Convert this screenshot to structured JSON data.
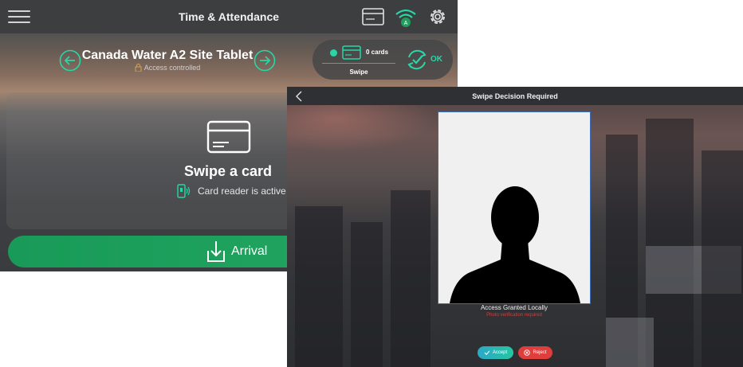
{
  "screen1": {
    "title": "Time & Attendance",
    "site_name": "Canada Water A2 Site Tablet",
    "access_status": "Access controlled",
    "cards_count": "0 cards",
    "swipe_label": "Swipe",
    "ok_label": "OK",
    "main_prompt": "Swipe a card",
    "reader_status": "Card reader is active",
    "arrival_label": "Arrival",
    "wifi_badge": "A",
    "colors": {
      "accent": "#27d7a6",
      "arrival_green": "#1e9f5c"
    }
  },
  "screen2": {
    "title": "Swipe Decision Required",
    "status": "Access Granted Locally",
    "sub_status": "Photo verification required",
    "accept_label": "Accept",
    "reject_label": "Reject",
    "colors": {
      "accept": "#27b8b4",
      "reject": "#e03d3d",
      "sub_status": "#d93b3b"
    }
  }
}
